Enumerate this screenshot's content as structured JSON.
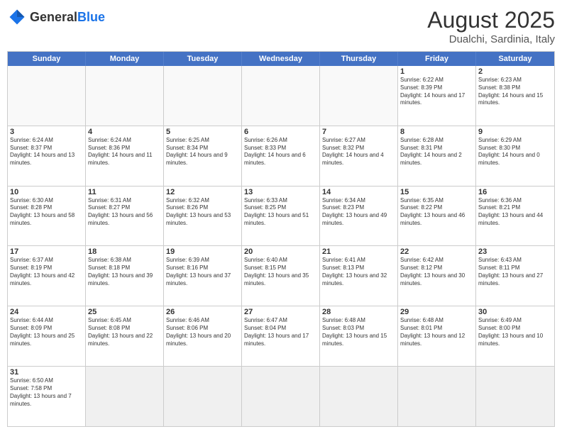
{
  "logo": {
    "general": "General",
    "blue": "Blue"
  },
  "header": {
    "month": "August 2025",
    "location": "Dualchi, Sardinia, Italy"
  },
  "weekdays": [
    "Sunday",
    "Monday",
    "Tuesday",
    "Wednesday",
    "Thursday",
    "Friday",
    "Saturday"
  ],
  "rows": [
    [
      {
        "day": "",
        "info": ""
      },
      {
        "day": "",
        "info": ""
      },
      {
        "day": "",
        "info": ""
      },
      {
        "day": "",
        "info": ""
      },
      {
        "day": "",
        "info": ""
      },
      {
        "day": "1",
        "info": "Sunrise: 6:22 AM\nSunset: 8:39 PM\nDaylight: 14 hours and 17 minutes."
      },
      {
        "day": "2",
        "info": "Sunrise: 6:23 AM\nSunset: 8:38 PM\nDaylight: 14 hours and 15 minutes."
      }
    ],
    [
      {
        "day": "3",
        "info": "Sunrise: 6:24 AM\nSunset: 8:37 PM\nDaylight: 14 hours and 13 minutes."
      },
      {
        "day": "4",
        "info": "Sunrise: 6:24 AM\nSunset: 8:36 PM\nDaylight: 14 hours and 11 minutes."
      },
      {
        "day": "5",
        "info": "Sunrise: 6:25 AM\nSunset: 8:34 PM\nDaylight: 14 hours and 9 minutes."
      },
      {
        "day": "6",
        "info": "Sunrise: 6:26 AM\nSunset: 8:33 PM\nDaylight: 14 hours and 6 minutes."
      },
      {
        "day": "7",
        "info": "Sunrise: 6:27 AM\nSunset: 8:32 PM\nDaylight: 14 hours and 4 minutes."
      },
      {
        "day": "8",
        "info": "Sunrise: 6:28 AM\nSunset: 8:31 PM\nDaylight: 14 hours and 2 minutes."
      },
      {
        "day": "9",
        "info": "Sunrise: 6:29 AM\nSunset: 8:30 PM\nDaylight: 14 hours and 0 minutes."
      }
    ],
    [
      {
        "day": "10",
        "info": "Sunrise: 6:30 AM\nSunset: 8:28 PM\nDaylight: 13 hours and 58 minutes."
      },
      {
        "day": "11",
        "info": "Sunrise: 6:31 AM\nSunset: 8:27 PM\nDaylight: 13 hours and 56 minutes."
      },
      {
        "day": "12",
        "info": "Sunrise: 6:32 AM\nSunset: 8:26 PM\nDaylight: 13 hours and 53 minutes."
      },
      {
        "day": "13",
        "info": "Sunrise: 6:33 AM\nSunset: 8:25 PM\nDaylight: 13 hours and 51 minutes."
      },
      {
        "day": "14",
        "info": "Sunrise: 6:34 AM\nSunset: 8:23 PM\nDaylight: 13 hours and 49 minutes."
      },
      {
        "day": "15",
        "info": "Sunrise: 6:35 AM\nSunset: 8:22 PM\nDaylight: 13 hours and 46 minutes."
      },
      {
        "day": "16",
        "info": "Sunrise: 6:36 AM\nSunset: 8:21 PM\nDaylight: 13 hours and 44 minutes."
      }
    ],
    [
      {
        "day": "17",
        "info": "Sunrise: 6:37 AM\nSunset: 8:19 PM\nDaylight: 13 hours and 42 minutes."
      },
      {
        "day": "18",
        "info": "Sunrise: 6:38 AM\nSunset: 8:18 PM\nDaylight: 13 hours and 39 minutes."
      },
      {
        "day": "19",
        "info": "Sunrise: 6:39 AM\nSunset: 8:16 PM\nDaylight: 13 hours and 37 minutes."
      },
      {
        "day": "20",
        "info": "Sunrise: 6:40 AM\nSunset: 8:15 PM\nDaylight: 13 hours and 35 minutes."
      },
      {
        "day": "21",
        "info": "Sunrise: 6:41 AM\nSunset: 8:13 PM\nDaylight: 13 hours and 32 minutes."
      },
      {
        "day": "22",
        "info": "Sunrise: 6:42 AM\nSunset: 8:12 PM\nDaylight: 13 hours and 30 minutes."
      },
      {
        "day": "23",
        "info": "Sunrise: 6:43 AM\nSunset: 8:11 PM\nDaylight: 13 hours and 27 minutes."
      }
    ],
    [
      {
        "day": "24",
        "info": "Sunrise: 6:44 AM\nSunset: 8:09 PM\nDaylight: 13 hours and 25 minutes."
      },
      {
        "day": "25",
        "info": "Sunrise: 6:45 AM\nSunset: 8:08 PM\nDaylight: 13 hours and 22 minutes."
      },
      {
        "day": "26",
        "info": "Sunrise: 6:46 AM\nSunset: 8:06 PM\nDaylight: 13 hours and 20 minutes."
      },
      {
        "day": "27",
        "info": "Sunrise: 6:47 AM\nSunset: 8:04 PM\nDaylight: 13 hours and 17 minutes."
      },
      {
        "day": "28",
        "info": "Sunrise: 6:48 AM\nSunset: 8:03 PM\nDaylight: 13 hours and 15 minutes."
      },
      {
        "day": "29",
        "info": "Sunrise: 6:48 AM\nSunset: 8:01 PM\nDaylight: 13 hours and 12 minutes."
      },
      {
        "day": "30",
        "info": "Sunrise: 6:49 AM\nSunset: 8:00 PM\nDaylight: 13 hours and 10 minutes."
      }
    ],
    [
      {
        "day": "31",
        "info": "Sunrise: 6:50 AM\nSunset: 7:58 PM\nDaylight: 13 hours and 7 minutes."
      },
      {
        "day": "",
        "info": ""
      },
      {
        "day": "",
        "info": ""
      },
      {
        "day": "",
        "info": ""
      },
      {
        "day": "",
        "info": ""
      },
      {
        "day": "",
        "info": ""
      },
      {
        "day": "",
        "info": ""
      }
    ]
  ]
}
